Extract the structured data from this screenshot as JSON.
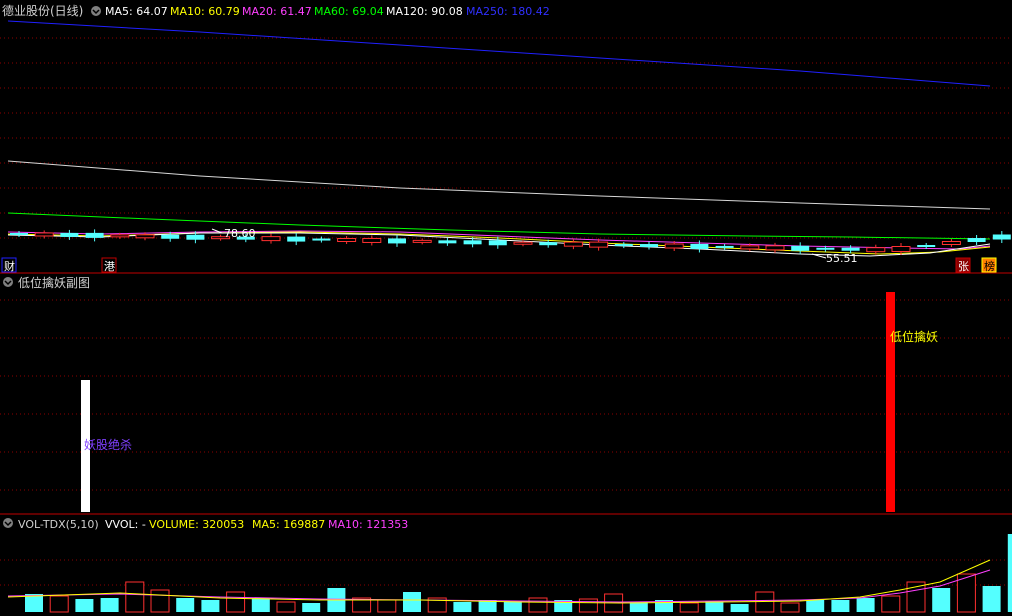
{
  "main_panel": {
    "stock_title": "德业股份(日线)",
    "ma_legend": [
      {
        "label": "MA5: 64.07",
        "color": "#ffffff"
      },
      {
        "label": "MA10: 60.79",
        "color": "#ffff00"
      },
      {
        "label": "MA20: 61.47",
        "color": "#ff40ff"
      },
      {
        "label": "MA60: 69.04",
        "color": "#00ff00"
      },
      {
        "label": "MA120: 90.08",
        "color": "#ffffff"
      },
      {
        "label": "MA250: 180.42",
        "color": "#2020ff"
      }
    ],
    "high_price_label": "78.60",
    "low_price_label": "55.51",
    "event_tags": [
      "财",
      "港",
      "张",
      "榜"
    ]
  },
  "indicator_panel": {
    "title": "低位擒妖副图",
    "signal_white_label": "妖股绝杀",
    "signal_red_label": "低位擒妖"
  },
  "volume_panel": {
    "title": "VOL-TDX(5,10)",
    "legend": [
      {
        "label": "VVOL: -",
        "color": "#ffffff"
      },
      {
        "label": "VOLUME: 320053",
        "color": "#ffff00"
      },
      {
        "label": "MA5: 169887",
        "color": "#ffff00"
      },
      {
        "label": "MA10: 121353",
        "color": "#ff40ff"
      }
    ]
  },
  "colors": {
    "background": "#000000",
    "panel_border": "#c00000",
    "grid_dotted": "#8b0000",
    "up_candle": "#ff3030",
    "down_candle": "#54ffff",
    "signal_red": "#ff0000",
    "signal_white": "#ffffff",
    "signal_red_text": "#ffff00",
    "signal_white_text": "#8040ff"
  }
}
